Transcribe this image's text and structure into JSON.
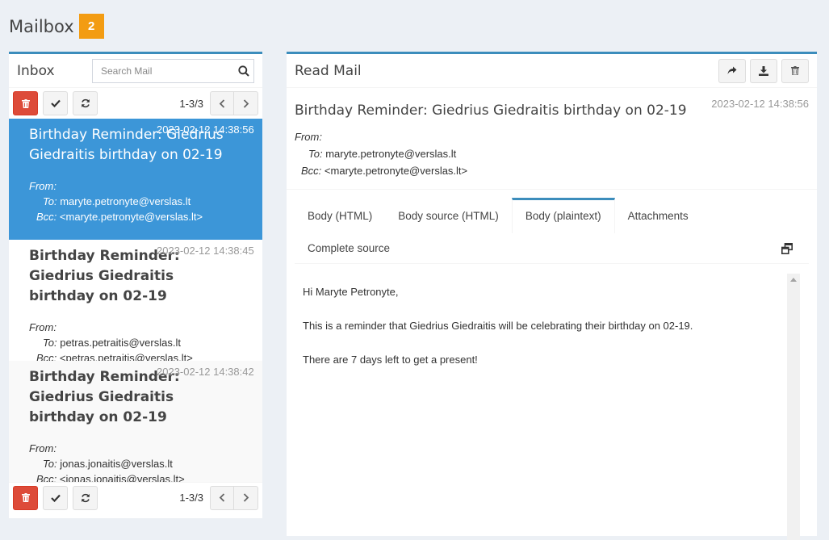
{
  "page": {
    "title": "Mailbox",
    "badge": "2"
  },
  "inbox": {
    "title": "Inbox",
    "search_placeholder": "Search Mail",
    "count": "1-3/3",
    "items": [
      {
        "subject": "Birthday Reminder: Giedrius Giedraitis birthday on 02-19",
        "date": "2023-02-12 14:38:56",
        "from_label": "From:",
        "to_label": "To:",
        "to": "maryte.petronyte@verslas.lt",
        "bcc_label": "Bcc:",
        "bcc": "<maryte.petronyte@verslas.lt>"
      },
      {
        "subject": "Birthday Reminder: Giedrius Giedraitis birthday on 02-19",
        "date": "2023-02-12 14:38:45",
        "from_label": "From:",
        "to_label": "To:",
        "to": "petras.petraitis@verslas.lt",
        "bcc_label": "Bcc:",
        "bcc": "<petras.petraitis@verslas.lt>"
      },
      {
        "subject": "Birthday Reminder: Giedrius Giedraitis birthday on 02-19",
        "date": "2023-02-12 14:38:42",
        "from_label": "From:",
        "to_label": "To:",
        "to": "jonas.jonaitis@verslas.lt",
        "bcc_label": "Bcc:",
        "bcc": "<jonas.jonaitis@verslas.lt>"
      }
    ]
  },
  "read": {
    "title": "Read Mail",
    "subject": "Birthday Reminder: Giedrius Giedraitis birthday on 02-19",
    "date": "2023-02-12 14:38:56",
    "from_label": "From:",
    "to_label": "To:",
    "to": "maryte.petronyte@verslas.lt",
    "bcc_label": "Bcc:",
    "bcc": "<maryte.petronyte@verslas.lt>",
    "tabs": [
      "Body (HTML)",
      "Body source (HTML)",
      "Body (plaintext)",
      "Attachments"
    ],
    "tab_complete": "Complete source",
    "active_tab": "Body (plaintext)",
    "body": [
      "Hi Maryte Petronyte,",
      "This is a reminder that Giedrius Giedraitis will be celebrating their birthday on 02-19.",
      "There are 7 days left to get a present!"
    ]
  },
  "colors": {
    "accent": "#3c8dbc",
    "danger": "#dd4b39",
    "badge": "#f39c12",
    "active_item": "#3c96d8"
  },
  "icons": [
    "search-icon",
    "trash-icon",
    "check-icon",
    "refresh-icon",
    "chevron-left-icon",
    "chevron-right-icon",
    "forward-icon",
    "download-icon",
    "expand-icon"
  ]
}
